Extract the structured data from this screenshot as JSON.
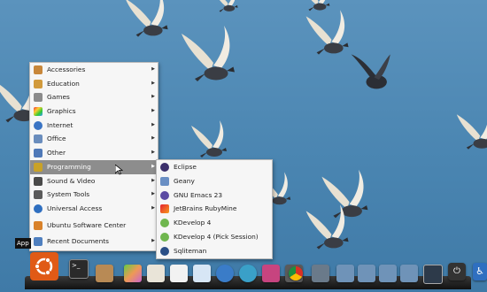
{
  "colors": {
    "wallpaper": "#4d86b0",
    "menu_background": "#f6f6f6",
    "menu_highlight": "#8d8d8d",
    "ubuntu_orange": "#e05a16"
  },
  "main_menu": {
    "items": [
      {
        "label": "Accessories",
        "icon": "accessories-icon",
        "has_submenu": true
      },
      {
        "label": "Education",
        "icon": "education-icon",
        "has_submenu": true
      },
      {
        "label": "Games",
        "icon": "games-icon",
        "has_submenu": true
      },
      {
        "label": "Graphics",
        "icon": "graphics-icon",
        "has_submenu": true
      },
      {
        "label": "Internet",
        "icon": "internet-icon",
        "has_submenu": true
      },
      {
        "label": "Office",
        "icon": "office-icon",
        "has_submenu": true
      },
      {
        "label": "Other",
        "icon": "other-icon",
        "has_submenu": true
      },
      {
        "label": "Programming",
        "icon": "programming-icon",
        "has_submenu": true,
        "active": true
      },
      {
        "label": "Sound & Video",
        "icon": "sound-video-icon",
        "has_submenu": true
      },
      {
        "label": "System Tools",
        "icon": "system-tools-icon",
        "has_submenu": true
      },
      {
        "label": "Universal Access",
        "icon": "universal-access-icon",
        "has_submenu": true
      },
      {
        "label": "Ubuntu Software Center",
        "icon": "software-center-icon",
        "has_submenu": false
      },
      {
        "label": "Recent Documents",
        "icon": "recent-documents-icon",
        "has_submenu": true
      }
    ]
  },
  "sub_menu": {
    "items": [
      {
        "label": "Eclipse",
        "icon": "eclipse-icon"
      },
      {
        "label": "Geany",
        "icon": "geany-icon"
      },
      {
        "label": "GNU Emacs 23",
        "icon": "emacs-icon"
      },
      {
        "label": "JetBrains RubyMine",
        "icon": "rubymine-icon"
      },
      {
        "label": "KDevelop 4",
        "icon": "kdevelop-icon"
      },
      {
        "label": "KDevelop 4 (Pick Session)",
        "icon": "kdevelop-session-icon"
      },
      {
        "label": "Sqliteman",
        "icon": "sqliteman-icon"
      }
    ]
  },
  "tooltip": {
    "text": "App"
  },
  "dock": {
    "icons": [
      "ubuntu-logo-icon",
      "terminal-icon",
      "archive-icon",
      "image-viewer-icon",
      "document-icon",
      "text-editor-icon",
      "presentation-icon",
      "browser-icon",
      "globe-icon",
      "media-player-icon",
      "chat-icon",
      "chrome-icon",
      "workspace-icon",
      "home-folder-icon",
      "folder-icon",
      "download-icon",
      "trash-icon",
      "desktop-icon",
      "power-icon",
      "accessibility-icon"
    ]
  }
}
